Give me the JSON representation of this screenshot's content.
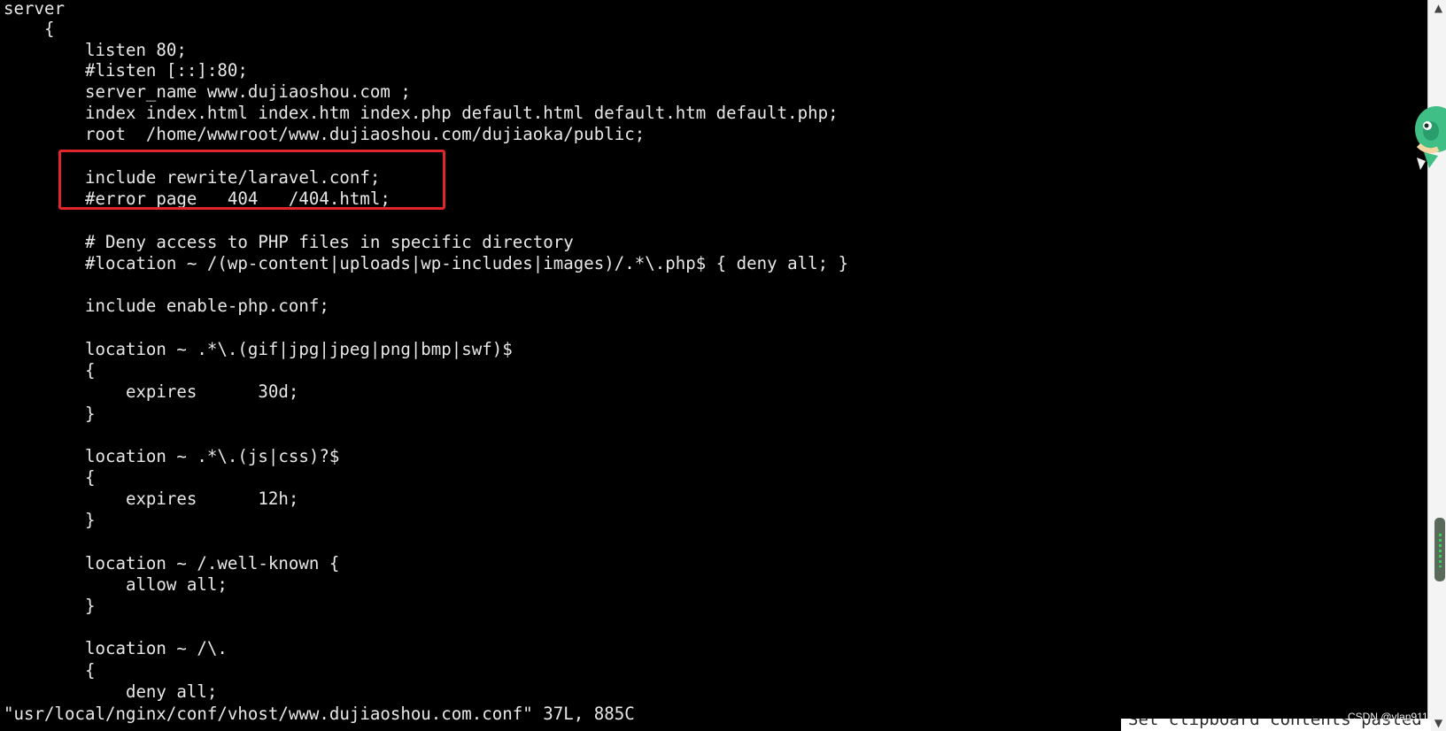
{
  "terminal": {
    "lines": [
      "server",
      "    {",
      "        listen 80;",
      "        #listen [::]:80;",
      "        server_name www.dujiaoshou.com ;",
      "        index index.html index.htm index.php default.html default.htm default.php;",
      "        root  /home/wwwroot/www.dujiaoshou.com/dujiaoka/public;",
      "",
      "        include rewrite/laravel.conf;",
      "        #error_page   404   /404.html;",
      "",
      "        # Deny access to PHP files in specific directory",
      "        #location ~ /(wp-content|uploads|wp-includes|images)/.*\\.php$ { deny all; }",
      "",
      "        include enable-php.conf;",
      "",
      "        location ~ .*\\.(gif|jpg|jpeg|png|bmp|swf)$",
      "        {",
      "            expires      30d;",
      "        }",
      "",
      "        location ~ .*\\.(js|css)?$",
      "        {",
      "            expires      12h;",
      "        }",
      "",
      "        location ~ /.well-known {",
      "            allow all;",
      "        }",
      "",
      "        location ~ /\\.",
      "        {",
      "            deny all;"
    ],
    "status_line": "\"usr/local/nginx/conf/vhost/www.dujiaoshou.com.conf\" 37L, 885C",
    "highlight_color": "#e0262b",
    "text_color": "#e8e8e8",
    "background_color": "#000000"
  },
  "clipboard_notice": "Set clipboard contents pasted",
  "watermark": "CSDN @vlan911",
  "scrollbar": {
    "up_icon": "▲",
    "down_icon": "▼"
  }
}
